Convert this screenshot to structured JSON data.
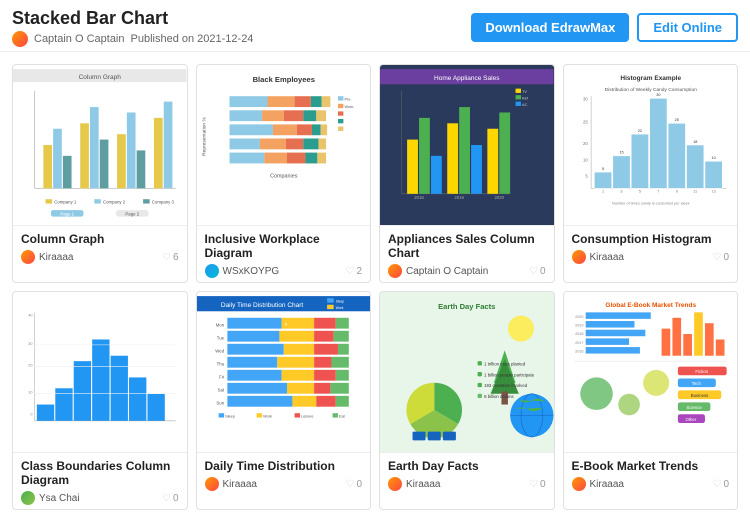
{
  "header": {
    "title": "Stacked Bar Chart",
    "author": "Captain O Captain",
    "published": "Published on 2021-12-24",
    "btn_download": "Download EdrawMax",
    "btn_edit": "Edit Online"
  },
  "cards": [
    {
      "id": "card-1",
      "title": "Column Graph",
      "author": "Kiraaaa",
      "likes": "6",
      "avatar_class": "avatar-tiny"
    },
    {
      "id": "card-2",
      "title": "Inclusive Workplace Diagram",
      "author": "WSxKOYPG",
      "likes": "2",
      "avatar_class": "avatar-tiny avatar-blue"
    },
    {
      "id": "card-3",
      "title": "Appliances Sales Column Chart",
      "author": "Captain O Captain",
      "likes": "0",
      "avatar_class": "avatar-tiny avatar-purple"
    },
    {
      "id": "card-4",
      "title": "Consumption Histogram",
      "author": "Kiraaaa",
      "likes": "0",
      "avatar_class": "avatar-tiny"
    },
    {
      "id": "card-5",
      "title": "Class Boundaries Column Diagram",
      "author": "Ysa Chai",
      "likes": "0",
      "avatar_class": "avatar-tiny avatar-green"
    },
    {
      "id": "card-6",
      "title": "Daily Time Distribution",
      "author": "Kiraaaa",
      "likes": "0",
      "avatar_class": "avatar-tiny"
    },
    {
      "id": "card-7",
      "title": "Earth Day Facts",
      "author": "Kiraaaa",
      "likes": "0",
      "avatar_class": "avatar-tiny"
    },
    {
      "id": "card-8",
      "title": "E-Book Market Trends",
      "author": "Kiraaaa",
      "likes": "0",
      "avatar_class": "avatar-tiny"
    }
  ]
}
